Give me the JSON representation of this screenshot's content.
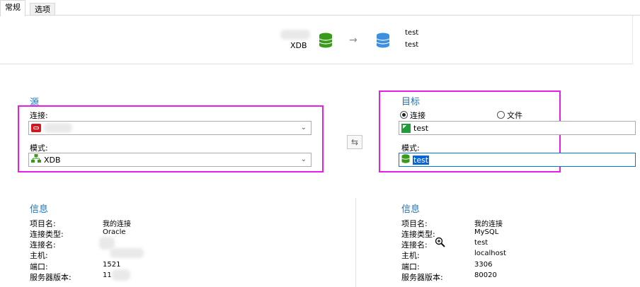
{
  "tabs": [
    {
      "label": "常规",
      "active": true
    },
    {
      "label": "选项",
      "active": false
    }
  ],
  "header": {
    "source_schema": "XDB",
    "target_line1": "test",
    "target_line2": "test",
    "arrow": "→"
  },
  "source": {
    "title": "源",
    "connection_label": "连接:",
    "connection_value": "",
    "schema_label": "模式:",
    "schema_value": "XDB"
  },
  "target": {
    "title": "目标",
    "radio_connection": "连接",
    "radio_file": "文件",
    "selected_radio": "connection",
    "connection_value": "test",
    "schema_label": "模式:",
    "schema_value": "test"
  },
  "source_info": {
    "title": "信息",
    "rows": [
      {
        "key": "项目名:",
        "value": "我的连接"
      },
      {
        "key": "连接类型:",
        "value": "Oracle"
      },
      {
        "key": "连接名:",
        "value": ""
      },
      {
        "key": "主机:",
        "value": ""
      },
      {
        "key": "端口:",
        "value": "1521"
      },
      {
        "key": "服务器版本:",
        "value": "11"
      }
    ]
  },
  "target_info": {
    "title": "信息",
    "rows": [
      {
        "key": "项目名:",
        "value": "我的连接"
      },
      {
        "key": "连接类型:",
        "value": "MySQL"
      },
      {
        "key": "连接名:",
        "value": "test"
      },
      {
        "key": "主机:",
        "value": "localhost"
      },
      {
        "key": "端口:",
        "value": "3306"
      },
      {
        "key": "服务器版本:",
        "value": "80020"
      }
    ]
  },
  "colors": {
    "highlight_border": "#e61ee6",
    "section_title": "#1e73be",
    "source_db": "#3a9a1a",
    "target_db": "#3d8fe0",
    "oracle_red": "#d9141c"
  }
}
